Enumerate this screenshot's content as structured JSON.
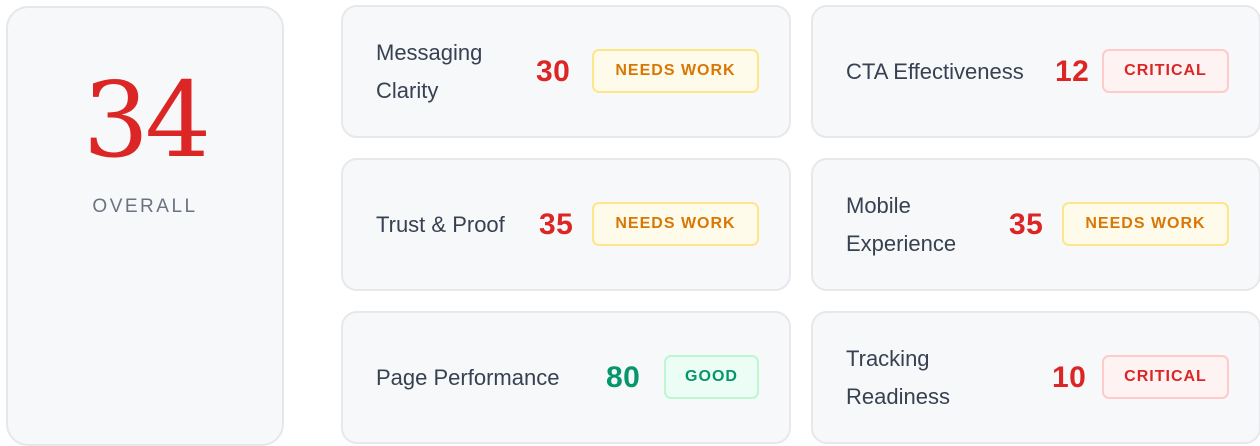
{
  "overall": {
    "score": "34",
    "label": "OVERALL"
  },
  "colors": {
    "critical": "#dc2626",
    "needs_work": "#d97706",
    "good": "#059669",
    "score_red": "#dc2626",
    "score_green": "#059669"
  },
  "metrics": [
    {
      "name_line1": "Messaging",
      "name_line2": "Clarity",
      "score": "30",
      "status": "NEEDS WORK"
    },
    {
      "name_line1": "CTA Effectiveness",
      "name_line2": "",
      "score": "12",
      "status": "CRITICAL"
    },
    {
      "name_line1": "Trust & Proof",
      "name_line2": "",
      "score": "35",
      "status": "NEEDS WORK"
    },
    {
      "name_line1": "Mobile",
      "name_line2": "Experience",
      "score": "35",
      "status": "NEEDS WORK"
    },
    {
      "name_line1": "Page Performance",
      "name_line2": "",
      "score": "80",
      "status": "GOOD"
    },
    {
      "name_line1": "Tracking",
      "name_line2": "Readiness",
      "score": "10",
      "status": "CRITICAL"
    }
  ]
}
